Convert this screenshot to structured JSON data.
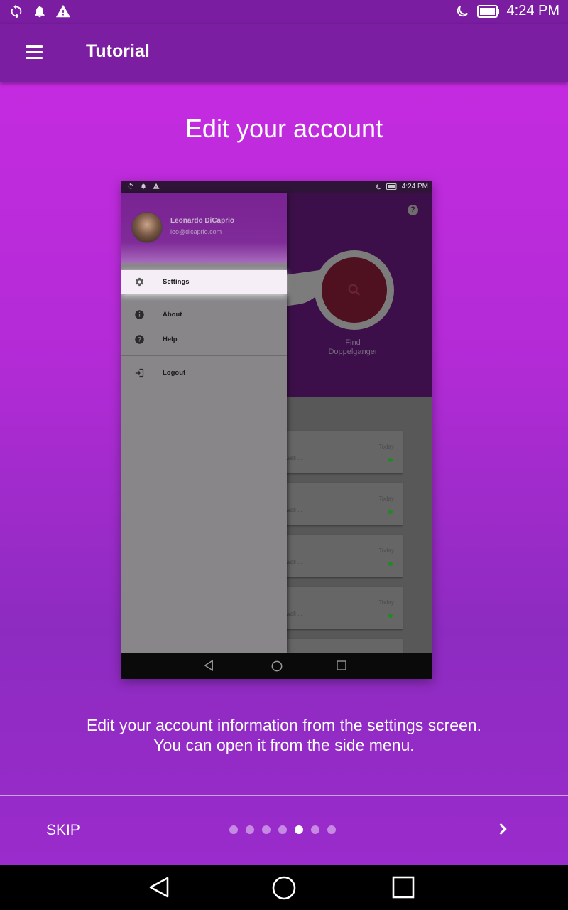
{
  "status_bar": {
    "time": "4:24 PM",
    "left_icons": [
      "sync-icon",
      "notification-bell-icon",
      "warning-icon"
    ],
    "right_icons": [
      "moon-icon",
      "battery-icon"
    ]
  },
  "app_bar": {
    "title": "Tutorial",
    "menu_icon": "hamburger-menu-icon"
  },
  "slide": {
    "title": "Edit your account",
    "description_line1": "Edit your account information from the settings screen.",
    "description_line2": "You can open it from the side menu."
  },
  "preview": {
    "status_time": "4:24 PM",
    "user_name": "Leonardo DiCaprio",
    "user_email": "leo@dicaprio.com",
    "drawer_items": [
      {
        "label": "Settings",
        "icon": "gear-icon",
        "active": true
      },
      {
        "label": "About",
        "icon": "info-icon",
        "active": false
      },
      {
        "label": "Help",
        "icon": "help-icon",
        "active": false
      },
      {
        "label": "Logout",
        "icon": "logout-icon",
        "active": false
      }
    ],
    "find_button_label_1": "Find",
    "find_button_label_2": "Doppelganger",
    "cards": [
      {
        "snippet": "well ...",
        "date": "Today"
      },
      {
        "snippet": "well ...",
        "date": "Today"
      },
      {
        "snippet": "well ...",
        "date": "Today"
      },
      {
        "snippet": "well ...",
        "date": "Today"
      }
    ]
  },
  "footer": {
    "skip_label": "SKIP",
    "page_count": 7,
    "current_page": 5,
    "next_icon": "chevron-right-icon"
  },
  "colors": {
    "app_bar": "#7b1ea2",
    "gradient_top": "#c42be0",
    "gradient_bottom": "#9a2bcc"
  }
}
